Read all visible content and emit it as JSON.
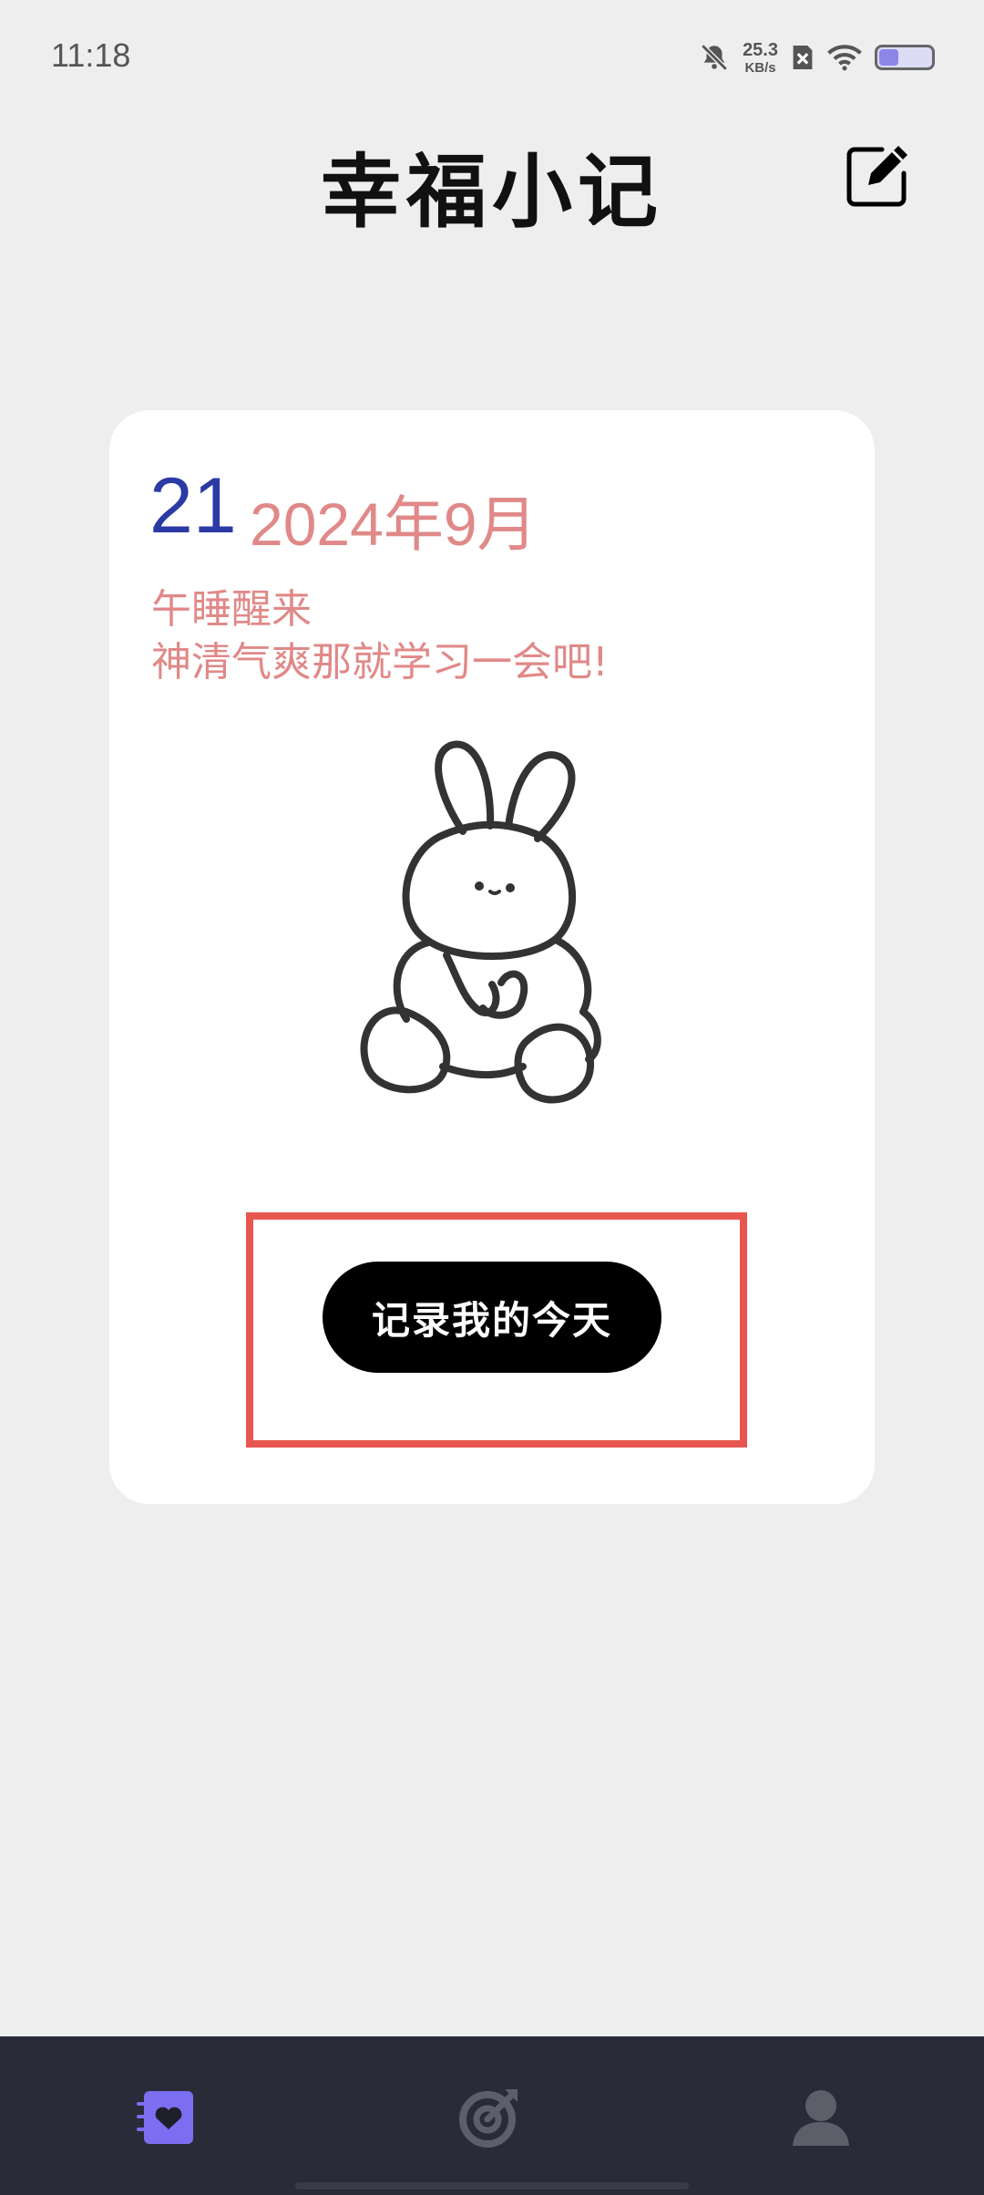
{
  "status_bar": {
    "time": "11:18",
    "net_speed_value": "25.3",
    "net_speed_unit": "KB/s",
    "icons": [
      "bell-muted-icon",
      "sim-off-icon",
      "wifi-icon",
      "battery-icon"
    ],
    "battery_level": 0.35
  },
  "header": {
    "title": "幸福小记",
    "edit_icon": "edit-note-icon"
  },
  "card": {
    "day": "21",
    "year_month": "2024年9月",
    "message_line1": "午睡醒来",
    "message_line2": "神清气爽那就学习一会吧!",
    "illustration": "bunny-illustration",
    "record_button": "记录我的今天"
  },
  "bottom_nav": {
    "items": [
      {
        "icon": "diary-heart-icon",
        "active": true
      },
      {
        "icon": "target-icon",
        "active": false
      },
      {
        "icon": "profile-icon",
        "active": false
      }
    ]
  },
  "colors": {
    "background": "#eeeeee",
    "accent_blue": "#2b3aa5",
    "accent_pink": "#e08988",
    "nav_bg": "#2a2b38",
    "highlight_red": "#e85650",
    "active_purple": "#7b6ef0"
  }
}
